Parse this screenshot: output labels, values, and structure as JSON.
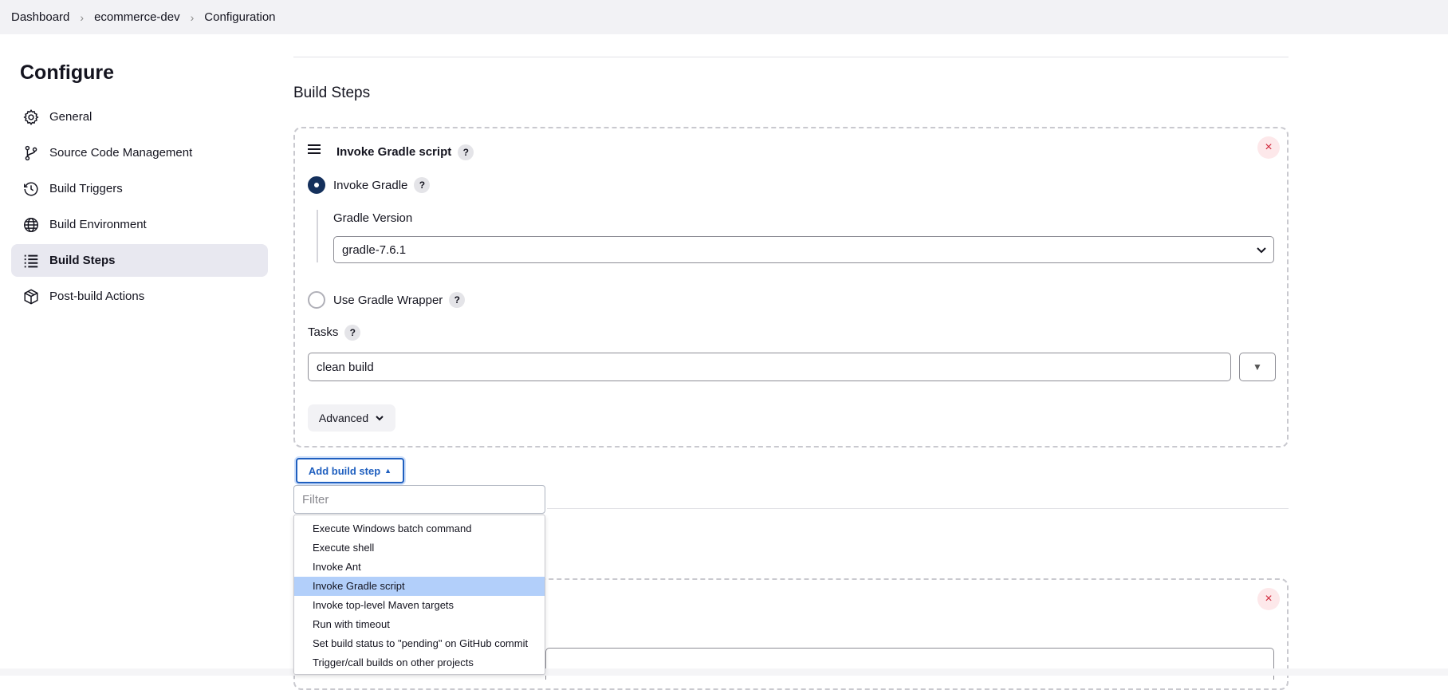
{
  "breadcrumb": [
    "Dashboard",
    "ecommerce-dev",
    "Configuration"
  ],
  "sidebar": {
    "title": "Configure",
    "items": [
      {
        "label": "General",
        "icon": "gear-icon"
      },
      {
        "label": "Source Code Management",
        "icon": "git-branch-icon"
      },
      {
        "label": "Build Triggers",
        "icon": "clock-icon"
      },
      {
        "label": "Build Environment",
        "icon": "globe-icon"
      },
      {
        "label": "Build Steps",
        "icon": "list-icon",
        "active": true
      },
      {
        "label": "Post-build Actions",
        "icon": "package-icon"
      }
    ]
  },
  "main": {
    "section_title": "Build Steps",
    "step": {
      "title": "Invoke Gradle script",
      "help": "?",
      "close": "×",
      "option_invoke_gradle": "Invoke Gradle",
      "gradle_version_label": "Gradle Version",
      "gradle_version_value": "gradle-7.6.1",
      "option_wrapper": "Use Gradle Wrapper",
      "tasks_label": "Tasks",
      "tasks_value": "clean build",
      "tasks_dropdown": "▼",
      "advanced_label": "Advanced"
    },
    "add_step_label": "Add build step",
    "filter_placeholder": "Filter",
    "menu_items": [
      "Execute Windows batch command",
      "Execute shell",
      "Invoke Ant",
      "Invoke Gradle script",
      "Invoke top-level Maven targets",
      "Run with timeout",
      "Set build status to \"pending\" on GitHub commit",
      "Trigger/call builds on other projects"
    ],
    "highlighted_index": 3
  },
  "colors": {
    "accent": "#1f5fbf",
    "highlight": "#b2cffa",
    "radio_checked": "#14305c",
    "close": "#d0263a"
  }
}
